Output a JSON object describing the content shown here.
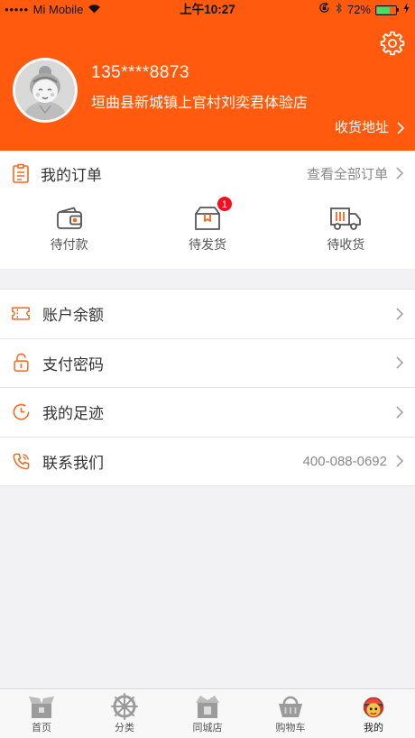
{
  "status_bar": {
    "signal": "●●●●●",
    "carrier": "Mi Mobile",
    "time": "上午10:27",
    "battery": "72%"
  },
  "profile": {
    "phone": "135****8873",
    "store_name": "垣曲县新城镇上官村刘奕君体验店",
    "address_label": "收货地址"
  },
  "orders": {
    "icon": "clipboard-icon",
    "title": "我的订单",
    "view_all": "查看全部订单",
    "items": [
      {
        "label": "待付款",
        "icon": "wallet-icon"
      },
      {
        "label": "待发货",
        "icon": "package-icon",
        "badge": "1"
      },
      {
        "label": "待收货",
        "icon": "truck-icon"
      }
    ]
  },
  "menu": [
    {
      "label": "账户余额",
      "icon": "ticket-icon"
    },
    {
      "label": "支付密码",
      "icon": "lock-icon"
    },
    {
      "label": "我的足迹",
      "icon": "clock-icon"
    },
    {
      "label": "联系我们",
      "icon": "phone-icon",
      "value": "400-088-0692"
    }
  ],
  "tabbar": [
    {
      "label": "首页",
      "icon": "home-icon"
    },
    {
      "label": "分类",
      "icon": "category-icon"
    },
    {
      "label": "同城店",
      "icon": "store-icon"
    },
    {
      "label": "购物车",
      "icon": "cart-icon"
    },
    {
      "label": "我的",
      "icon": "profile-icon",
      "active": true
    }
  ],
  "colors": {
    "accent": "#FF5A0E",
    "icon": "#F5681E",
    "badge": "#F2101F",
    "battery": "#4CD964"
  }
}
